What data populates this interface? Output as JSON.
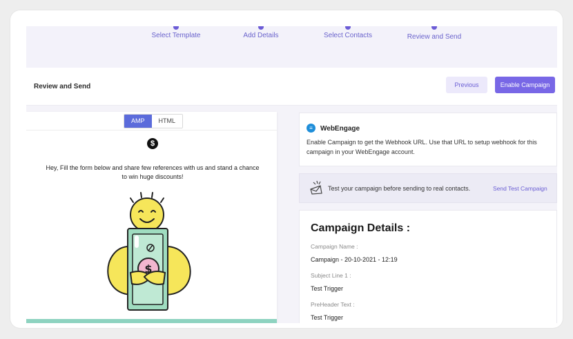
{
  "stepper": {
    "steps": [
      {
        "label": "Select Template"
      },
      {
        "label": "Add Details"
      },
      {
        "label": "Select Contacts"
      },
      {
        "label": "Review and Send"
      }
    ]
  },
  "header": {
    "title": "Review and Send",
    "previous_label": "Previous",
    "enable_label": "Enable Campaign"
  },
  "preview": {
    "tabs": [
      "AMP",
      "HTML"
    ],
    "active_tab": "AMP",
    "dollar_symbol": "$",
    "message": "Hey, Fill the form below and share few references with us and stand a chance to win huge discounts!"
  },
  "webengage": {
    "title": "WebEngage",
    "description": "Enable Campaign to get the Webhook URL. Use that URL to setup webhook for this campaign in your WebEngage account."
  },
  "test": {
    "text": "Test your campaign before sending to real contacts.",
    "link": "Send Test Campaign"
  },
  "details": {
    "title": "Campaign Details :",
    "fields": [
      {
        "label": "Campaign Name :",
        "value": "Campaign - 20-10-2021 - 12:19"
      },
      {
        "label": "Subject Line 1 :",
        "value": "Test Trigger"
      },
      {
        "label": "PreHeader Text :",
        "value": "Test Trigger"
      }
    ]
  },
  "colors": {
    "accent": "#7867e6",
    "accent_light": "#ece9fb",
    "green": "#8ed3c0"
  }
}
